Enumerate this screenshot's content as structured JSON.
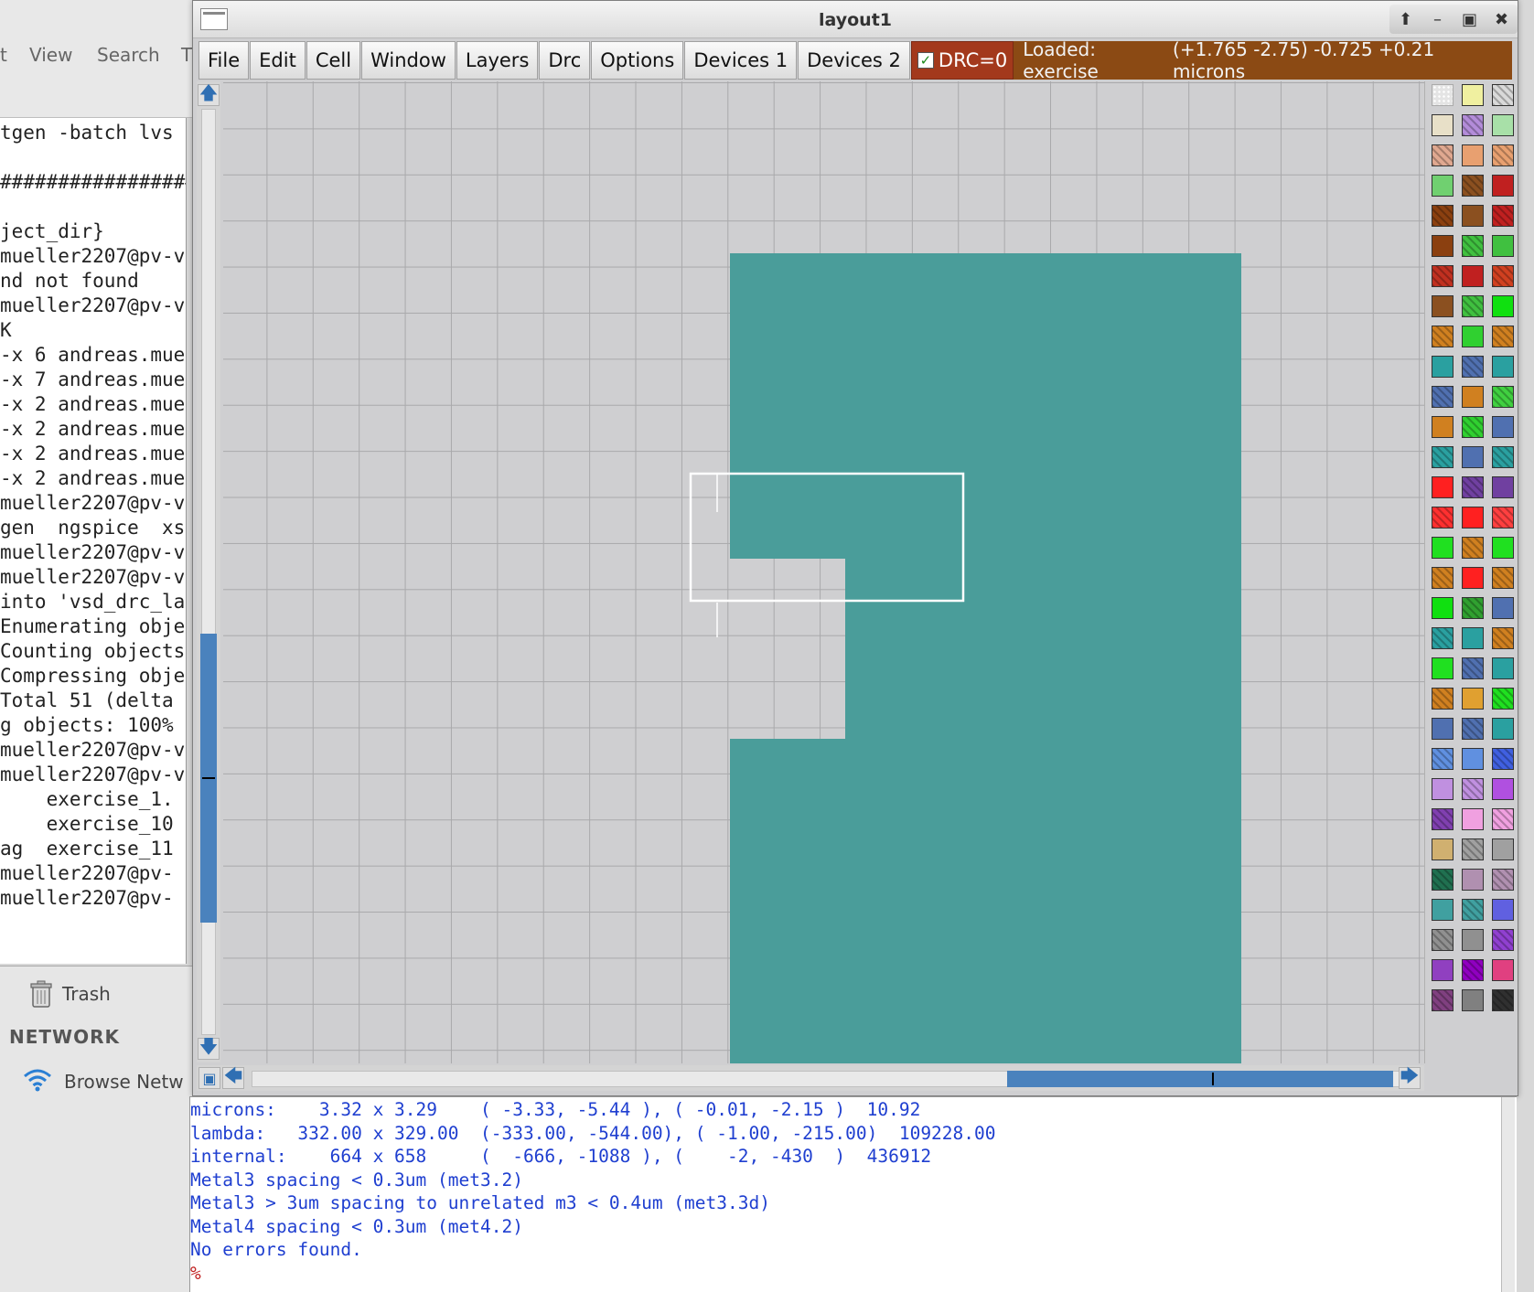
{
  "terminal": {
    "menu": [
      "t",
      "View",
      "Search",
      "T"
    ],
    "lines": [
      "tgen -batch lvs",
      "",
      "#################",
      "",
      "ject_dir}",
      "mueller2207@pv-v",
      "nd not found",
      "mueller2207@pv-v",
      "K",
      "-x 6 andreas.mue",
      "-x 7 andreas.mue",
      "-x 2 andreas.mue",
      "-x 2 andreas.mue",
      "-x 2 andreas.mue",
      "-x 2 andreas.mue",
      "mueller2207@pv-v",
      "gen  ngspice  xs",
      "mueller2207@pv-v",
      "mueller2207@pv-v",
      "into 'vsd_drc_la",
      "Enumerating obje",
      "Counting objects",
      "Compressing obje",
      "Total 51 (delta",
      "g objects: 100%",
      "mueller2207@pv-v",
      "mueller2207@pv-v",
      "    exercise_1.",
      "    exercise_10",
      "ag  exercise_11",
      "mueller2207@pv-",
      "mueller2207@pv-"
    ]
  },
  "file_manager": {
    "trash_label": "Trash",
    "network_heading": "NETWORK",
    "browse_label": "Browse Netw"
  },
  "window": {
    "title": "layout1",
    "controls": [
      "up-icon",
      "minimize-icon",
      "maximize-icon",
      "close-icon"
    ]
  },
  "menu": {
    "items": [
      "File",
      "Edit",
      "Cell",
      "Window",
      "Layers",
      "Drc",
      "Options",
      "Devices 1",
      "Devices 2"
    ],
    "drc_label": "DRC=0",
    "status_loaded": "Loaded: exercise",
    "status_coords": "(+1.765 -2.75) -0.725 +0.21 microns"
  },
  "colors": {
    "metal3": "#4a9d9a",
    "drc_bg": "#a3391c",
    "status_bg": "#8b4a14",
    "console_text": "#1f3fd0",
    "scroll_thumb": "#4a82bd"
  },
  "palette": {
    "swatches": [
      [
        "dots-white",
        "#f0f0a0",
        "#d9d9d9"
      ],
      [
        "#e8e0c8",
        "#b38cd9",
        "#a8e0a8"
      ],
      [
        "#e0a890",
        "#e8a070",
        "#e8a070"
      ],
      [
        "#70d070",
        "#8b5020",
        "#c02020"
      ],
      [
        "#8b4010",
        "#8b5020",
        "#c02020"
      ],
      [
        "#8b4010",
        "#40c040",
        "#40c040"
      ],
      [
        "#c03020",
        "#c02020",
        "#d04020"
      ],
      [
        "#8b5020",
        "#40c040",
        "#10e010"
      ],
      [
        "#d08020",
        "#30d030",
        "#d08020"
      ],
      [
        "#2aa0a0",
        "#5070b0",
        "#2aa0a0"
      ],
      [
        "#5070b0",
        "#d08020",
        "#40d040"
      ],
      [
        "#d08020",
        "#30d030",
        "#5070b0"
      ],
      [
        "#2aa0a0",
        "#5070b0",
        "#2aa0a0"
      ],
      [
        "#ff2020",
        "#7040a0",
        "#7040a0"
      ],
      [
        "#ff3030",
        "#ff2020",
        "#ff4040"
      ],
      [
        "#20e020",
        "#d08020",
        "#20e020"
      ],
      [
        "#d08020",
        "#ff2020",
        "#d08020"
      ],
      [
        "#10e010",
        "#30a030",
        "#5070b0"
      ],
      [
        "#2aa0a0",
        "#2aa0a0",
        "#d08020"
      ],
      [
        "#20e020",
        "#5070b0",
        "#2aa0a0"
      ],
      [
        "#d08020",
        "#e0a030",
        "#20e020"
      ],
      [
        "#5070b0",
        "#5070b0",
        "#2aa0a0"
      ],
      [
        "#6090e0",
        "#6090e0",
        "#4060e0"
      ],
      [
        "#c090e0",
        "#c090e0",
        "#b050e0"
      ],
      [
        "#8040b0",
        "#f0a0e0",
        "#f0a0e0"
      ],
      [
        "#d0b070",
        "#a0a0a0",
        "#a0a0a0"
      ],
      [
        "#207050",
        "#b090b0",
        "#b090b0"
      ],
      [
        "#40a0a0",
        "#40a0a0",
        "#6060e0"
      ],
      [
        "#909090",
        "#909090",
        "#9040d0"
      ],
      [
        "#9040c0",
        "#9000c0",
        "#e04080"
      ],
      [
        "#804080",
        "#808080",
        "#303030"
      ]
    ]
  },
  "console": {
    "lines": [
      "microns:    3.32 x 3.29    ( -3.33, -5.44 ), ( -0.01, -2.15 )  10.92",
      "lambda:   332.00 x 329.00  (-333.00, -544.00), ( -1.00, -215.00)  109228.00",
      "internal:    664 x 658     (  -666, -1088 ), (    -2, -430  )  436912",
      "Metal3 spacing < 0.3um (met3.2)",
      "Metal3 > 3um spacing to unrelated m3 < 0.4um (met3.3d)",
      "Metal4 spacing < 0.3um (met4.2)",
      "No errors found."
    ],
    "prompt": "%"
  }
}
